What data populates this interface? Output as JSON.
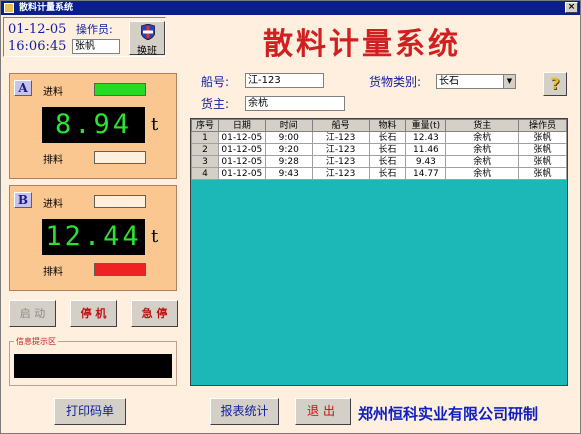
{
  "window": {
    "title": "散料计量系统",
    "close_label": "×"
  },
  "header": {
    "date": "01-12-05",
    "time": "16:06:45",
    "operator_label": "操作员:",
    "operator_value": "张帆",
    "swap_label": "换班",
    "app_title": "散料计量系统"
  },
  "scale_a": {
    "letter": "A",
    "in_label": "进料",
    "reading": "8.94",
    "unit": "t",
    "out_label": "排料",
    "in_status_color": "#22dd22",
    "out_status_color": "#ffefdf"
  },
  "scale_b": {
    "letter": "B",
    "in_label": "进料",
    "reading": "12.44",
    "unit": "t",
    "out_label": "排料",
    "in_status_color": "#ffefdf",
    "out_status_color": "#ee2222"
  },
  "controls": {
    "start": "启 动",
    "stop": "停 机",
    "estop": "急 停"
  },
  "message_area": {
    "caption": "信息提示区"
  },
  "form": {
    "ship_label": "船号:",
    "ship_value": "江-123",
    "cargo_type_label": "货物类别:",
    "cargo_type_value": "长石",
    "owner_label": "货主:",
    "owner_value": "余杭",
    "help": "?"
  },
  "table": {
    "headers": [
      "序号",
      "日期",
      "时间",
      "船号",
      "物料",
      "重量(t)",
      "货主",
      "操作员"
    ],
    "rows": [
      [
        "1",
        "01-12-05",
        "9:00",
        "江-123",
        "长石",
        "12.43",
        "余杭",
        "张帆"
      ],
      [
        "2",
        "01-12-05",
        "9:20",
        "江-123",
        "长石",
        "11.46",
        "余杭",
        "张帆"
      ],
      [
        "3",
        "01-12-05",
        "9:28",
        "江-123",
        "长石",
        "9.43",
        "余杭",
        "张帆"
      ],
      [
        "4",
        "01-12-05",
        "9:43",
        "江-123",
        "长石",
        "14.77",
        "余杭",
        "张帆"
      ]
    ]
  },
  "footer": {
    "print_label": "打印码单",
    "report_label": "报表统计",
    "exit_label": "退出",
    "credit": "郑州恒科实业有限公司研制"
  }
}
